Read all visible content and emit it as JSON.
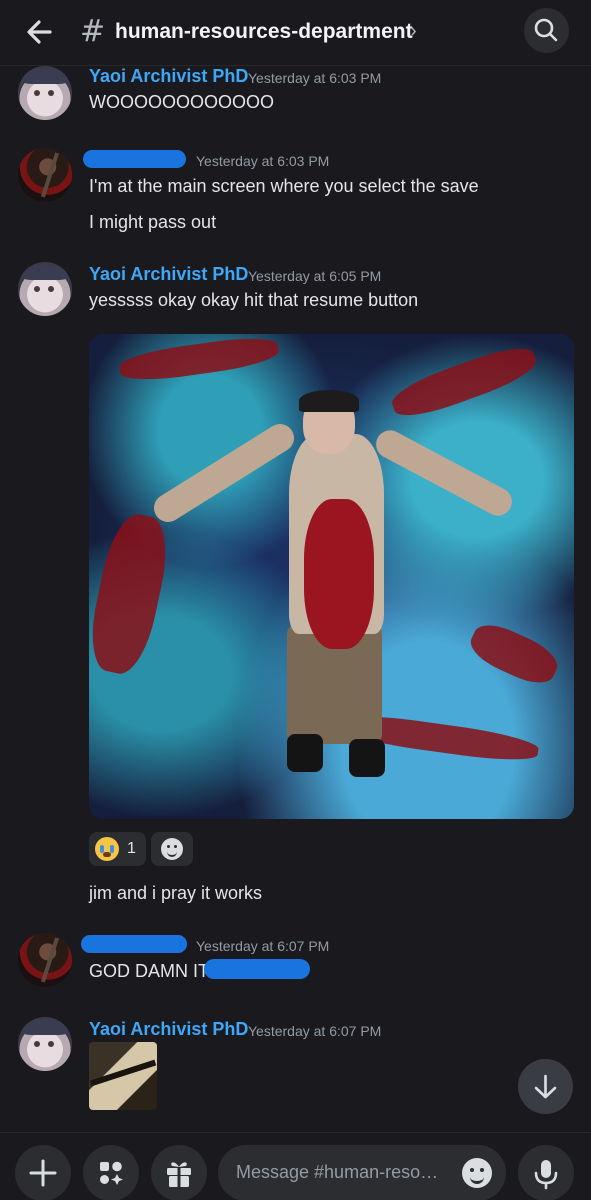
{
  "header": {
    "channel_symbol": "#",
    "channel_name": "human-resources-department",
    "chevron": "›",
    "back_icon": "arrow-left-icon",
    "search_icon": "search-icon"
  },
  "messages": [
    {
      "author": "Yaoi Archivist PhD",
      "author_redacted": false,
      "timestamp": "Yesterday at 6:03 PM",
      "lines": [
        "WOOOOOOOOOOOO"
      ]
    },
    {
      "author": "",
      "author_redacted": true,
      "timestamp": "Yesterday at 6:03 PM",
      "lines": [
        "I'm at the main screen where you select the save",
        "I might pass out"
      ]
    },
    {
      "author": "Yaoi Archivist PhD",
      "author_redacted": false,
      "timestamp": "Yesterday at 6:05 PM",
      "lines": [
        "yesssss okay okay hit that resume button"
      ],
      "attachment": "image",
      "reaction": {
        "emoji": "loudly-crying-face",
        "count": "1"
      },
      "follow_up": "jim and i pray it works"
    },
    {
      "author": "",
      "author_redacted": true,
      "timestamp": "Yesterday at 6:07 PM",
      "lines": [
        "GOD DAMN IT"
      ]
    },
    {
      "author": "Yaoi Archivist PhD",
      "author_redacted": false,
      "timestamp": "Yesterday at 6:07 PM",
      "attachment": "thumbnail"
    }
  ],
  "composer": {
    "placeholder": "Message #human-resources-department"
  },
  "colors": {
    "background": "#1a1a1e",
    "username": "#3ea7f7",
    "redaction": "#1a74e0",
    "timestamp": "#949ba4",
    "surface": "#2b2d31"
  }
}
